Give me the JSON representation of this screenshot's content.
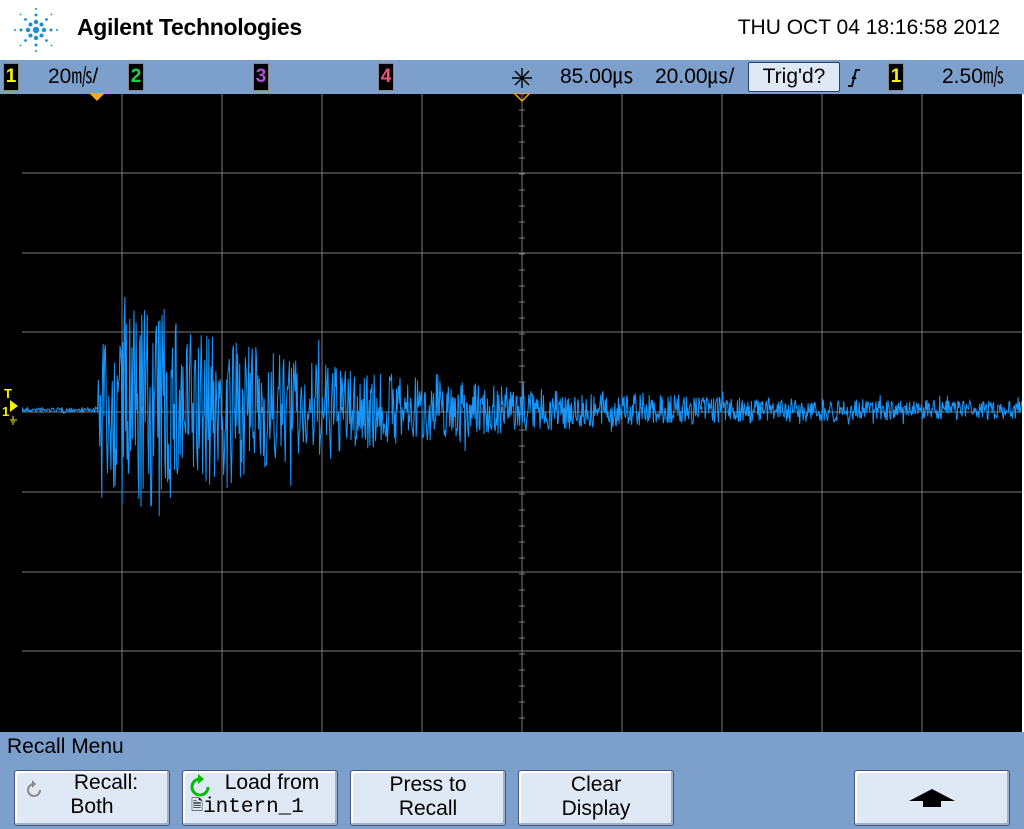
{
  "header": {
    "brand": "Agilent Technologies",
    "datetime": "THU OCT 04 18:16:58 2012"
  },
  "status": {
    "ch1": {
      "num": "1",
      "scale": "20㎧/",
      "color": "#f6f300"
    },
    "ch2": {
      "num": "2",
      "color": "#19d34a"
    },
    "ch3": {
      "num": "3",
      "color": "#b050d8"
    },
    "ch4": {
      "num": "4",
      "color": "#f2507a"
    },
    "delay": "85.00㎲",
    "timebase": "20.00㎲/",
    "trigger_state": "Trig'd?",
    "trigger_slope_icon": "rising-edge-icon",
    "trigger_source": "1",
    "trigger_level": "2.50㎧"
  },
  "screen": {
    "trace_color": "#1597ff",
    "grid_color": "#7b7b7b",
    "marker_color": "#f5a623",
    "ground_marker_label": "1",
    "trigger_marker_label": "T"
  },
  "menu": {
    "title": "Recall Menu",
    "softkeys": [
      {
        "line1": "Recall:",
        "line2": "Both",
        "icon": "recall-cycle-icon"
      },
      {
        "line1": "Load from",
        "line2": "intern_1",
        "icon": "refresh-green-icon"
      },
      {
        "line1": "Press to",
        "line2": "Recall"
      },
      {
        "line1": "Clear",
        "line2": "Display"
      },
      {
        "icon": "up-arrow-icon"
      }
    ]
  }
}
